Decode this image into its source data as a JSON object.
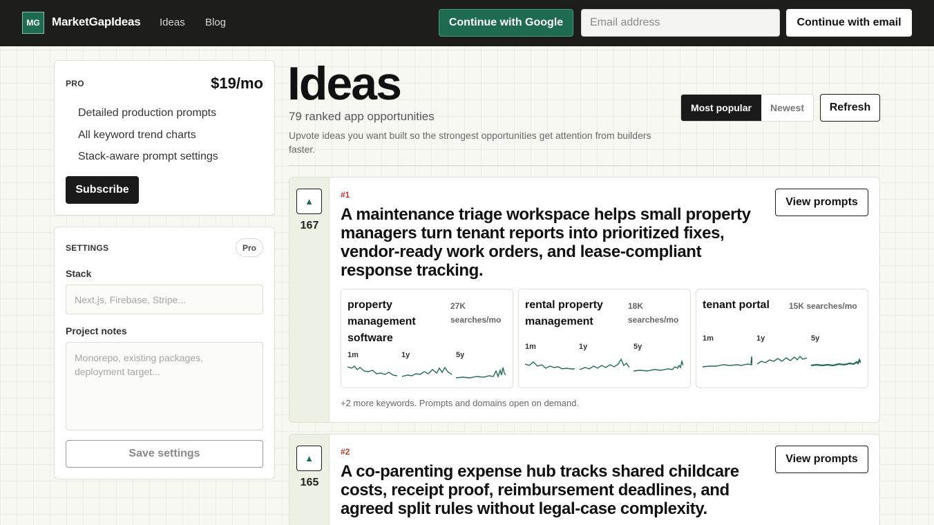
{
  "colors": {
    "accent": "#1f6b52",
    "rank": "#c0392b",
    "topbar": "#1d1d1b",
    "spark": "#1f6b52"
  },
  "header": {
    "logo_text": "MG",
    "brand": "MarketGapIdeas",
    "nav": [
      "Ideas",
      "Blog"
    ],
    "google_button": "Continue with Google",
    "email_placeholder": "Email address",
    "email_button": "Continue with email"
  },
  "pro": {
    "label": "PRO",
    "price": "$19/mo",
    "features": [
      "Detailed production prompts",
      "All keyword trend charts",
      "Stack-aware prompt settings"
    ],
    "subscribe": "Subscribe"
  },
  "settings": {
    "label": "SETTINGS",
    "badge": "Pro",
    "stack_label": "Stack",
    "stack_placeholder": "Next.js, Firebase, Stripe...",
    "notes_label": "Project notes",
    "notes_placeholder": "Monorepo, existing packages, deployment target...",
    "save": "Save settings"
  },
  "main": {
    "title": "Ideas",
    "count": "79 ranked app opportunities",
    "description": "Upvote ideas you want built so the strongest opportunities get attention from builders faster.",
    "sort_options": [
      "Most popular",
      "Newest"
    ],
    "refresh": "Refresh"
  },
  "ideas": [
    {
      "votes": "167",
      "rank": "#1",
      "title": "A maintenance triage workspace helps small property managers turn tenant reports into prioritized fixes, vendor-ready work orders, and lease-compliant response tracking.",
      "view": "View prompts",
      "keywords": [
        {
          "name": "property management software",
          "volume": "27K searches/mo"
        },
        {
          "name": "rental property management",
          "volume": "18K searches/mo"
        },
        {
          "name": "tenant portal",
          "volume": "15K searches/mo"
        }
      ],
      "spark_labels": [
        "1m",
        "1y",
        "5y"
      ],
      "more": "+2 more keywords. Prompts and domains open on demand."
    },
    {
      "votes": "165",
      "rank": "#2",
      "title": "A co-parenting expense hub tracks shared childcare costs, receipt proof, reimbursement deadlines, and agreed split rules without legal-case complexity.",
      "view": "View prompts"
    }
  ]
}
